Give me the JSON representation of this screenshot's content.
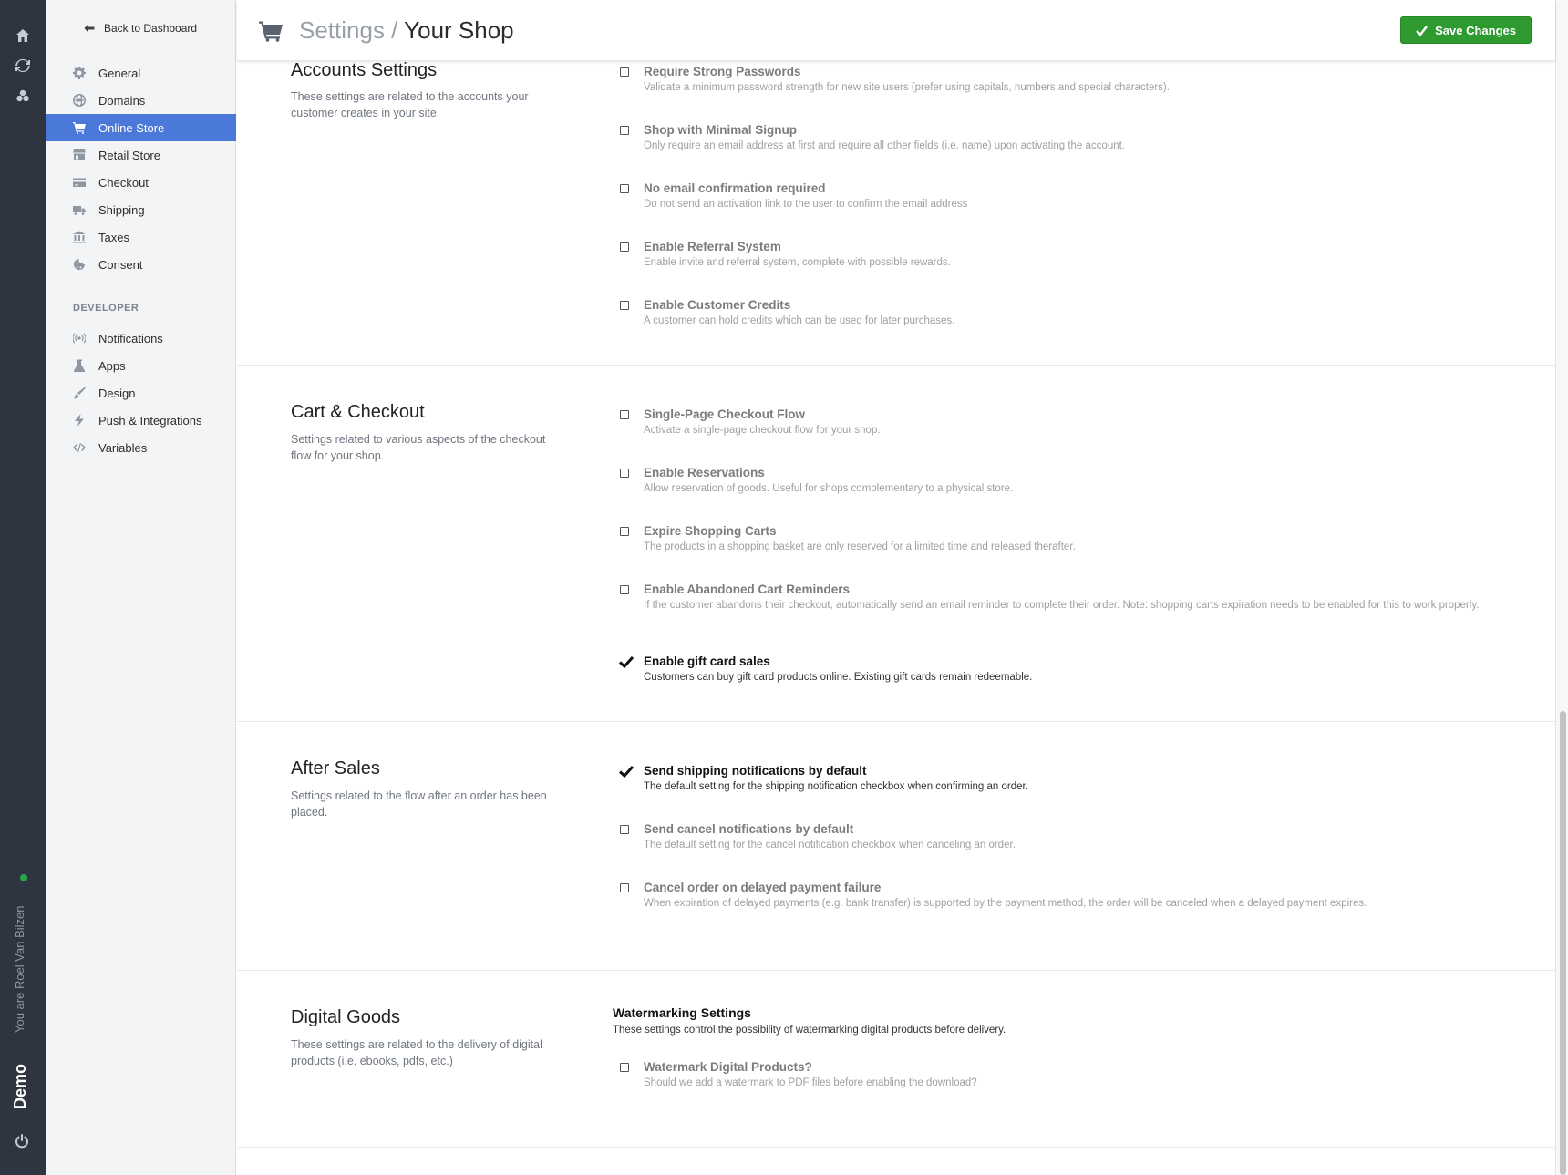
{
  "rail": {
    "icons": [
      "home-icon",
      "refresh-icon",
      "apps-icon"
    ],
    "user_text": "You are Roel Van Bilzen",
    "env_label": "Demo"
  },
  "sidebar": {
    "back_label": "Back to Dashboard",
    "items": [
      {
        "label": "General",
        "icon": "gear-icon"
      },
      {
        "label": "Domains",
        "icon": "globe-icon"
      },
      {
        "label": "Online Store",
        "icon": "cart-icon",
        "active": true
      },
      {
        "label": "Retail Store",
        "icon": "store-icon"
      },
      {
        "label": "Checkout",
        "icon": "credit-card-icon"
      },
      {
        "label": "Shipping",
        "icon": "truck-icon"
      },
      {
        "label": "Taxes",
        "icon": "bank-icon"
      },
      {
        "label": "Consent",
        "icon": "cookie-icon"
      }
    ],
    "developer_heading": "DEVELOPER",
    "dev_items": [
      {
        "label": "Notifications",
        "icon": "broadcast-icon"
      },
      {
        "label": "Apps",
        "icon": "flask-icon"
      },
      {
        "label": "Design",
        "icon": "brush-icon"
      },
      {
        "label": "Push & Integrations",
        "icon": "bolt-icon"
      },
      {
        "label": "Variables",
        "icon": "code-icon"
      }
    ]
  },
  "header": {
    "crumb_parent": "Settings",
    "crumb_sep": " / ",
    "crumb_current": "Your Shop",
    "save_label": "Save Changes"
  },
  "sections": {
    "accounts": {
      "title": "Accounts Settings",
      "desc": "These settings are related to the accounts your customer creates in your site.",
      "options": [
        {
          "title": "Require Strong Passwords",
          "desc": "Validate a minimum password strength for new site users (prefer using capitals, numbers and special characters).",
          "checked": false
        },
        {
          "title": "Shop with Minimal Signup",
          "desc": "Only require an email address at first and require all other fields (i.e. name) upon activating the account.",
          "checked": false
        },
        {
          "title": "No email confirmation required",
          "desc": "Do not send an activation link to the user to confirm the email address",
          "checked": false
        },
        {
          "title": "Enable Referral System",
          "desc": "Enable invite and referral system, complete with possible rewards.",
          "checked": false
        },
        {
          "title": "Enable Customer Credits",
          "desc": "A customer can hold credits which can be used for later purchases.",
          "checked": false
        }
      ]
    },
    "cart": {
      "title": "Cart & Checkout",
      "desc": "Settings related to various aspects of the checkout flow for your shop.",
      "options": [
        {
          "title": "Single-Page Checkout Flow",
          "desc": "Activate a single-page checkout flow for your shop.",
          "checked": false
        },
        {
          "title": "Enable Reservations",
          "desc": "Allow reservation of goods. Useful for shops complementary to a physical store.",
          "checked": false
        },
        {
          "title": "Expire Shopping Carts",
          "desc": "The products in a shopping basket are only reserved for a limited time and released therafter.",
          "checked": false
        },
        {
          "title": "Enable Abandoned Cart Reminders",
          "desc": "If the customer abandons their checkout, automatically send an email reminder to complete their order. Note: shopping carts expiration needs to be enabled for this to work properly.",
          "checked": false
        },
        {
          "title": "Enable gift card sales",
          "desc": "Customers can buy gift card products online. Existing gift cards remain redeemable.",
          "checked": true
        }
      ]
    },
    "after": {
      "title": "After Sales",
      "desc": "Settings related to the flow after an order has been placed.",
      "options": [
        {
          "title": "Send shipping notifications by default",
          "desc": "The default setting for the shipping notification checkbox when confirming an order.",
          "checked": true
        },
        {
          "title": "Send cancel notifications by default",
          "desc": "The default setting for the cancel notification checkbox when canceling an order.",
          "checked": false
        },
        {
          "title": "Cancel order on delayed payment failure",
          "desc": "When expiration of delayed payments (e.g. bank transfer) is supported by the payment method, the order will be canceled when a delayed payment expires.",
          "checked": false
        }
      ]
    },
    "digital": {
      "title": "Digital Goods",
      "desc": "These settings are related to the delivery of digital products (i.e. ebooks, pdfs, etc.)",
      "sub_head": "Watermarking Settings",
      "sub_desc": "These settings control the possibility of watermarking digital products before delivery.",
      "options": [
        {
          "title": "Watermark Digital Products?",
          "desc": "Should we add a watermark to PDF files before enabling the download?",
          "checked": false
        }
      ]
    }
  },
  "colors": {
    "accent": "#4a79d9",
    "save_green": "#2f9a2f",
    "rail_bg": "#2f3540",
    "sidebar_bg": "#f3f4f6"
  }
}
